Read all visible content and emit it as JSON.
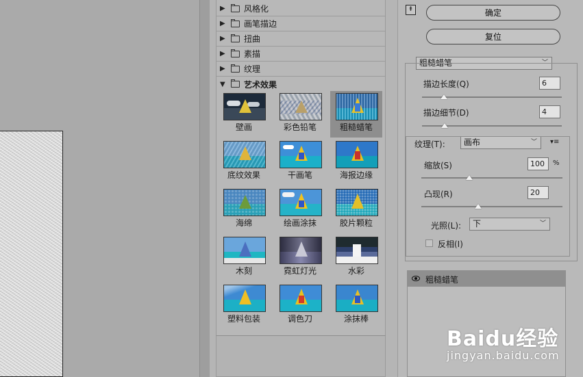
{
  "preview": {},
  "filters": {
    "categories": [
      {
        "label": "风格化",
        "arrow": "▶"
      },
      {
        "label": "画笔描边",
        "arrow": "▶"
      },
      {
        "label": "扭曲",
        "arrow": "▶"
      },
      {
        "label": "素描",
        "arrow": "▶"
      },
      {
        "label": "纹理",
        "arrow": "▶"
      },
      {
        "label": "艺术效果",
        "arrow": "▼"
      }
    ],
    "thumbnails": [
      "壁画",
      "彩色铅笔",
      "粗糙蜡笔",
      "底纹效果",
      "干画笔",
      "海报边缘",
      "海绵",
      "绘画涂抹",
      "胶片颗粒",
      "木刻",
      "霓虹灯光",
      "水彩",
      "塑料包装",
      "调色刀",
      "涂抹棒"
    ],
    "selected_index": 2
  },
  "panel": {
    "collapse_icon": "⇞",
    "ok_label": "确定",
    "reset_label": "复位",
    "filter_select": "粗糙蜡笔",
    "stroke_length_label": "描边长度(Q)",
    "stroke_length_value": "6",
    "stroke_detail_label": "描边细节(D)",
    "stroke_detail_value": "4",
    "texture_label": "纹理(T):",
    "texture_select": "画布",
    "texture_menu_icon": "▾≡",
    "scaling_label": "缩放(S)",
    "scaling_value": "100",
    "scaling_unit": "%",
    "relief_label": "凸现(R)",
    "relief_value": "20",
    "light_label": "光照(L):",
    "light_select": "下",
    "invert_label": "反相(I)",
    "invert_checked": false,
    "slider_levels": {
      "stroke_length": 6,
      "stroke_detail": 4,
      "scaling": 100,
      "relief": 20
    }
  },
  "layers": {
    "layer_name": "粗糙蜡笔"
  },
  "watermark": {
    "brand": "Baidu经验",
    "url": "jingyan.baidu.com"
  }
}
